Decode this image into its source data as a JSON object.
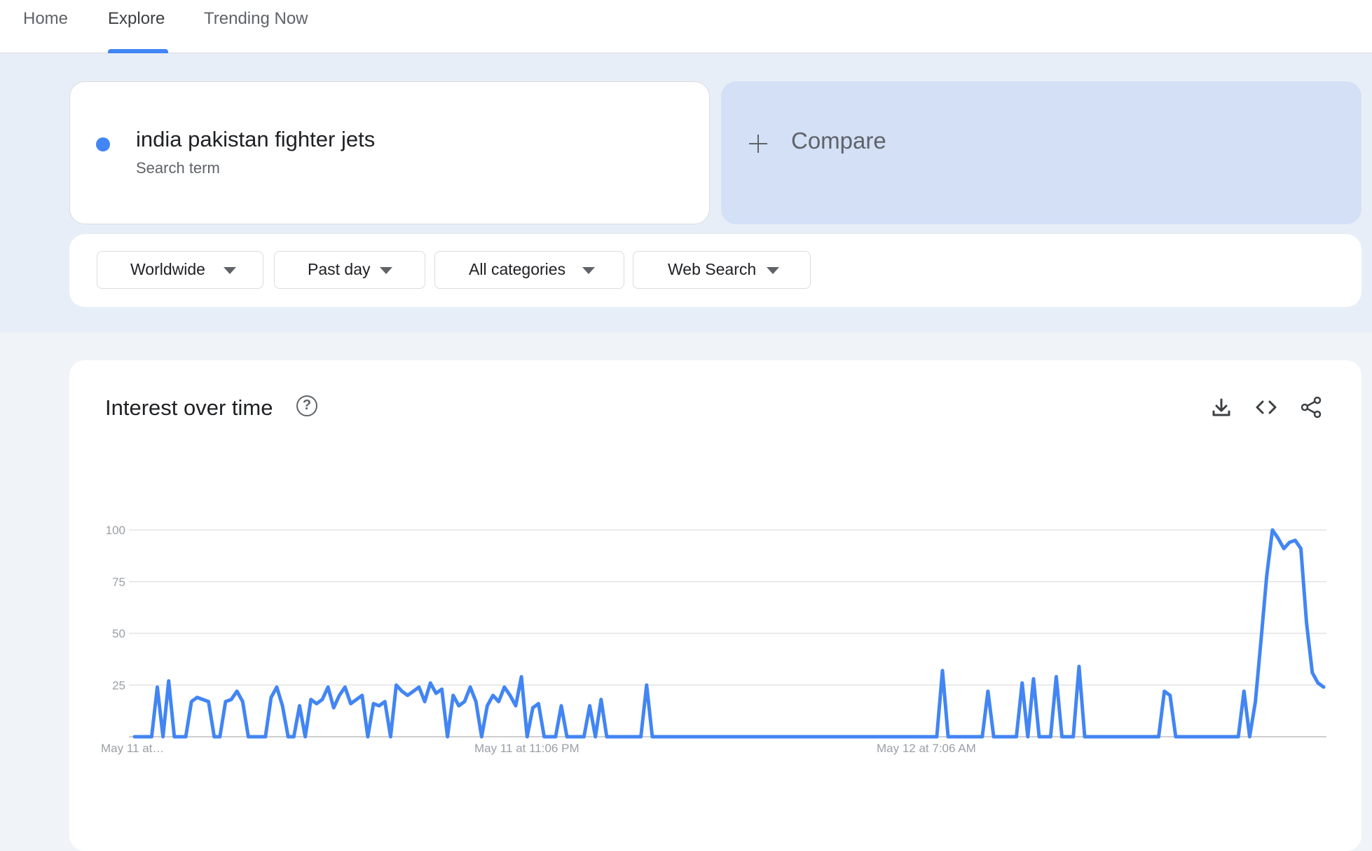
{
  "nav": {
    "tabs": [
      {
        "label": "Home"
      },
      {
        "label": "Explore"
      },
      {
        "label": "Trending Now"
      }
    ],
    "active": "Explore"
  },
  "search_term": {
    "name": "india pakistan fighter jets",
    "type": "Search term",
    "color": "#4285f4"
  },
  "compare": {
    "label": "Compare",
    "icon": "plus-icon"
  },
  "filters": [
    {
      "label": "Worldwide"
    },
    {
      "label": "Past day"
    },
    {
      "label": "All categories"
    },
    {
      "label": "Web Search"
    }
  ],
  "chart_card": {
    "title": "Interest over time",
    "icons": [
      "help-icon",
      "download-icon",
      "embed-code-icon",
      "share-icon"
    ]
  },
  "chart_data": {
    "type": "line",
    "title": "Interest over time",
    "xlabel": "",
    "ylabel": "",
    "ylim": [
      0,
      100
    ],
    "yticks": [
      25,
      50,
      75,
      100
    ],
    "xtick_labels": [
      "May 11 at…",
      "May 11 at 11:06 PM",
      "May 12 at 7:06 AM"
    ],
    "grid": true,
    "line_color": "#4285f4",
    "series": [
      {
        "values": [
          0,
          0,
          0,
          0,
          24,
          0,
          27,
          0,
          0,
          0,
          17,
          19,
          18,
          17,
          0,
          0,
          17,
          18,
          22,
          17,
          0,
          0,
          0,
          0,
          19,
          24,
          15,
          0,
          0,
          15,
          0,
          18,
          16,
          18,
          24,
          14,
          20,
          24,
          16,
          18,
          20,
          0,
          16,
          15,
          17,
          0,
          25,
          22,
          20,
          22,
          24,
          17,
          26,
          21,
          23,
          0,
          20,
          15,
          17,
          24,
          17,
          0,
          15,
          20,
          17,
          24,
          20,
          15,
          29,
          0,
          14,
          16,
          0,
          0,
          0,
          15,
          0,
          0,
          0,
          0,
          15,
          0,
          18,
          0,
          0,
          0,
          0,
          0,
          0,
          0,
          25,
          0,
          0,
          0,
          0,
          0,
          0,
          0,
          0,
          0,
          0,
          0,
          0,
          0,
          0,
          0,
          0,
          0,
          0,
          0,
          0,
          0,
          0,
          0,
          0,
          0,
          0,
          0,
          0,
          0,
          0,
          0,
          0,
          0,
          0,
          0,
          0,
          0,
          0,
          0,
          0,
          0,
          0,
          0,
          0,
          0,
          0,
          0,
          0,
          0,
          0,
          0,
          32,
          0,
          0,
          0,
          0,
          0,
          0,
          0,
          22,
          0,
          0,
          0,
          0,
          0,
          26,
          0,
          28,
          0,
          0,
          0,
          29,
          0,
          0,
          0,
          34,
          0,
          0,
          0,
          0,
          0,
          0,
          0,
          0,
          0,
          0,
          0,
          0,
          0,
          0,
          22,
          20,
          0,
          0,
          0,
          0,
          0,
          0,
          0,
          0,
          0,
          0,
          0,
          0,
          22,
          0,
          17,
          47,
          78,
          100,
          96,
          91,
          94,
          95,
          91,
          55,
          31,
          26,
          24
        ]
      }
    ]
  }
}
